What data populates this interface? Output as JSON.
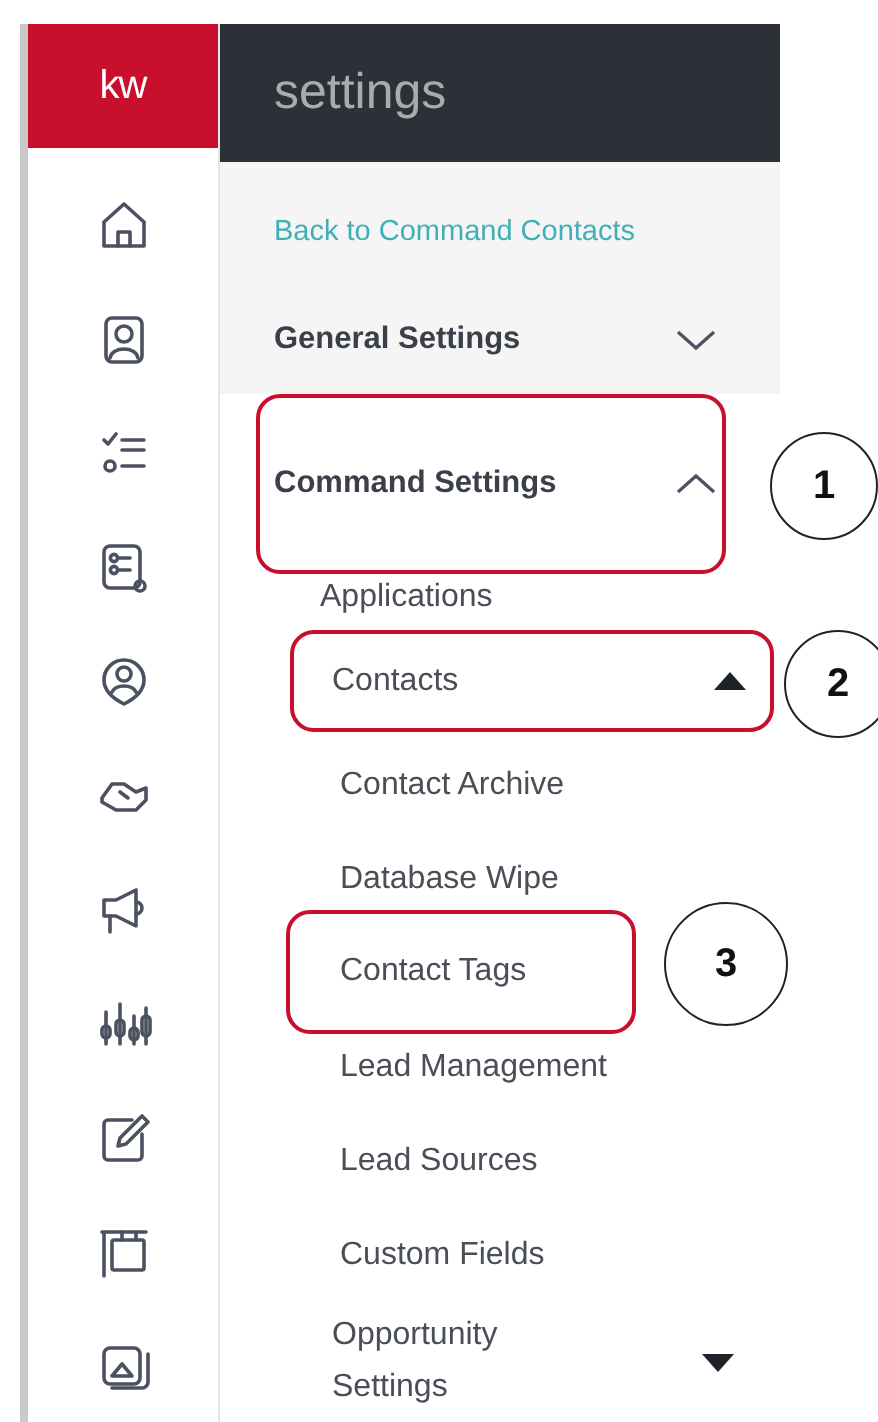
{
  "logo": "kw",
  "header": {
    "title": "settings"
  },
  "back_link": "Back to Command Contacts",
  "sections": [
    {
      "label": "General Settings",
      "expanded": false,
      "highlighted": false
    },
    {
      "label": "Command Settings",
      "expanded": true,
      "highlighted": true,
      "callout": "1",
      "children": [
        {
          "label": "Applications",
          "highlighted": false
        },
        {
          "label": "Contacts",
          "expanded": true,
          "highlighted": true,
          "callout": "2",
          "children": [
            {
              "label": "Contact Archive",
              "highlighted": false
            },
            {
              "label": "Database Wipe",
              "highlighted": false
            },
            {
              "label": "Contact Tags",
              "highlighted": true,
              "callout": "3"
            },
            {
              "label": "Lead Management",
              "highlighted": false
            },
            {
              "label": "Lead Sources",
              "highlighted": false
            },
            {
              "label": "Custom Fields",
              "highlighted": false
            }
          ]
        },
        {
          "label": "Opportunity Settings",
          "expanded": false,
          "highlighted": false
        }
      ]
    }
  ]
}
